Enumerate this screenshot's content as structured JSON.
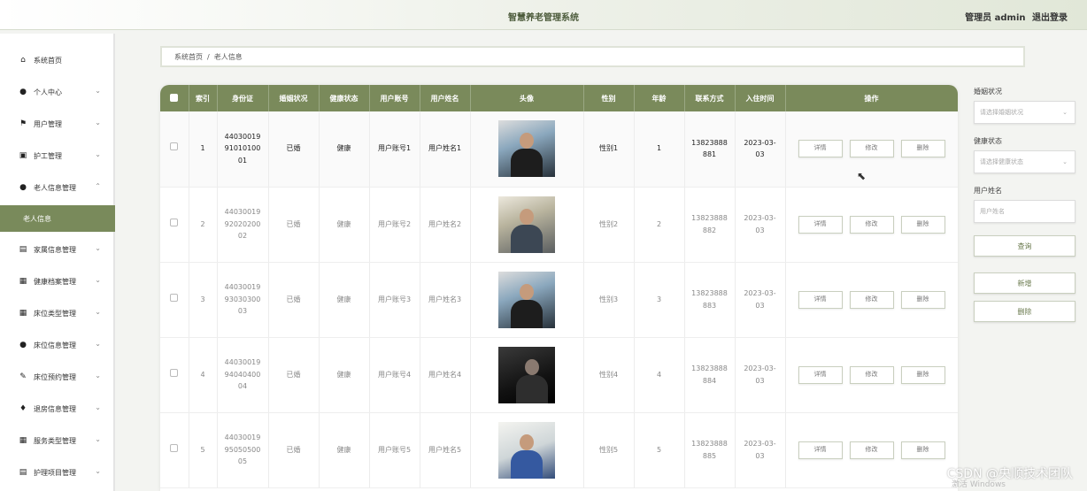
{
  "header": {
    "title": "智慧养老管理系统",
    "role": "管理员 admin",
    "logout": "退出登录"
  },
  "sidebar": {
    "items": [
      {
        "label": "系统首页",
        "icon": "home-icon",
        "glyph": "⌂"
      },
      {
        "label": "个人中心",
        "icon": "user-icon",
        "glyph": "●"
      },
      {
        "label": "用户管理",
        "icon": "flag-icon",
        "glyph": "⚑"
      },
      {
        "label": "护工管理",
        "icon": "printer-icon",
        "glyph": "▣"
      },
      {
        "label": "老人信息管理",
        "icon": "user-icon",
        "glyph": "●"
      },
      {
        "label": "家属信息管理",
        "icon": "bank-icon",
        "glyph": "▤"
      },
      {
        "label": "健康档案管理",
        "icon": "grid-icon",
        "glyph": "▦"
      },
      {
        "label": "床位类型管理",
        "icon": "grid-icon",
        "glyph": "▦"
      },
      {
        "label": "床位信息管理",
        "icon": "user-icon",
        "glyph": "●"
      },
      {
        "label": "床位预约管理",
        "icon": "edit-icon",
        "glyph": "✎"
      },
      {
        "label": "退房信息管理",
        "icon": "pin-icon",
        "glyph": "♦"
      },
      {
        "label": "服务类型管理",
        "icon": "grid-icon",
        "glyph": "▦"
      },
      {
        "label": "护理项目管理",
        "icon": "calendar-icon",
        "glyph": "▤"
      }
    ],
    "active_sub": "老人信息"
  },
  "breadcrumb": {
    "home": "系统首页",
    "sep": "/",
    "current": "老人信息"
  },
  "table": {
    "columns": [
      "索引",
      "身份证",
      "婚姻状况",
      "健康状态",
      "用户账号",
      "用户姓名",
      "头像",
      "性别",
      "年龄",
      "联系方式",
      "入住时间",
      "操作"
    ],
    "rows": [
      {
        "idx": "1",
        "id1": "44030019",
        "id2": "91010100",
        "id3": "01",
        "marital": "已婚",
        "health": "健康",
        "account": "用户账号1",
        "name": "用户姓名1",
        "gender": "性别1",
        "age": "1",
        "phone1": "13823888",
        "phone2": "881",
        "date1": "2023-03-",
        "date2": "03"
      },
      {
        "idx": "2",
        "id1": "44030019",
        "id2": "92020200",
        "id3": "02",
        "marital": "已婚",
        "health": "健康",
        "account": "用户账号2",
        "name": "用户姓名2",
        "gender": "性别2",
        "age": "2",
        "phone1": "13823888",
        "phone2": "882",
        "date1": "2023-03-",
        "date2": "03"
      },
      {
        "idx": "3",
        "id1": "44030019",
        "id2": "93030300",
        "id3": "03",
        "marital": "已婚",
        "health": "健康",
        "account": "用户账号3",
        "name": "用户姓名3",
        "gender": "性别3",
        "age": "3",
        "phone1": "13823888",
        "phone2": "883",
        "date1": "2023-03-",
        "date2": "03"
      },
      {
        "idx": "4",
        "id1": "44030019",
        "id2": "94040400",
        "id3": "04",
        "marital": "已婚",
        "health": "健康",
        "account": "用户账号4",
        "name": "用户姓名4",
        "gender": "性别4",
        "age": "4",
        "phone1": "13823888",
        "phone2": "884",
        "date1": "2023-03-",
        "date2": "03"
      },
      {
        "idx": "5",
        "id1": "44030019",
        "id2": "95050500",
        "id3": "05",
        "marital": "已婚",
        "health": "健康",
        "account": "用户账号5",
        "name": "用户姓名5",
        "gender": "性别5",
        "age": "5",
        "phone1": "13823888",
        "phone2": "885",
        "date1": "2023-03-",
        "date2": "03"
      }
    ],
    "ops": {
      "detail": "详情",
      "edit": "修改",
      "delete": "删除"
    }
  },
  "filters": {
    "marital_label": "婚姻状况",
    "marital_placeholder": "请选择婚姻状况",
    "health_label": "健康状态",
    "health_placeholder": "请选择健康状态",
    "name_label": "用户姓名",
    "name_placeholder": "用户姓名",
    "search": "查询",
    "add": "新增",
    "delete": "删除"
  },
  "watermark": "CSDN @央顺技术团队",
  "win_watermark": "激活 Windows",
  "colors": {
    "accent": "#7a8a5b",
    "active_sidebar": "#798a5b"
  }
}
